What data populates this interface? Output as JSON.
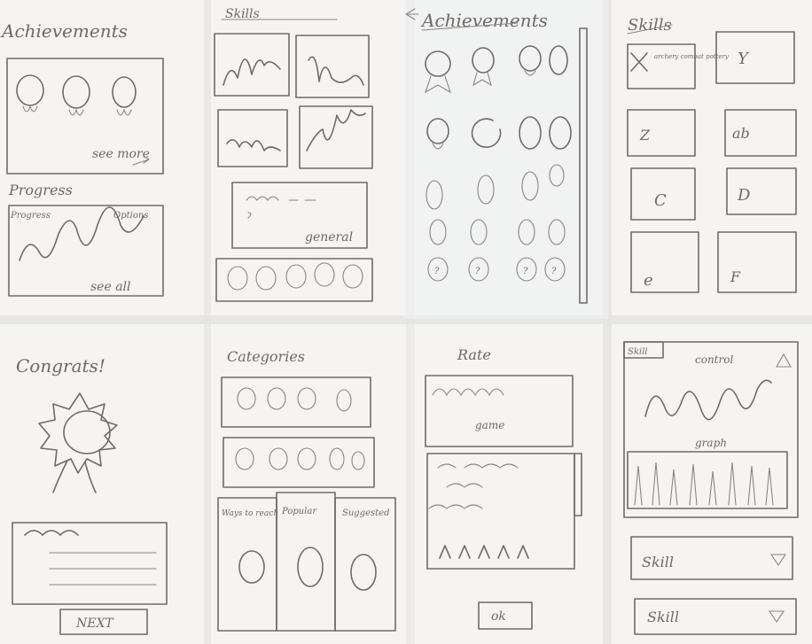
{
  "labels": {
    "achievements_left": "Achievements",
    "see_more": "see more",
    "progress": "Progress",
    "progress_left": "Progress",
    "progress_right": "Options",
    "see_all": "see all",
    "skills_top": "Skills",
    "general": "general",
    "achievements_mid": "Achievements",
    "skills_right": "Skills",
    "skill_card_text": "archery combat pottery",
    "card_y": "Y",
    "card_z": "Z",
    "card_ab": "ab",
    "card_c": "C",
    "card_d": "D",
    "card_e": "e",
    "card_f": "F",
    "congrats": "Congrats!",
    "next": "NEXT",
    "categories": "Categories",
    "ways_to_reach": "Ways to reach",
    "popular": "Popular",
    "suggested": "Suggested",
    "rate": "Rate",
    "game": "game",
    "ok": "ok",
    "skill_tab": "Skill",
    "control": "control",
    "graph": "graph",
    "skill_dropdown_1": "Skill",
    "skill_dropdown_2": "Skill"
  }
}
